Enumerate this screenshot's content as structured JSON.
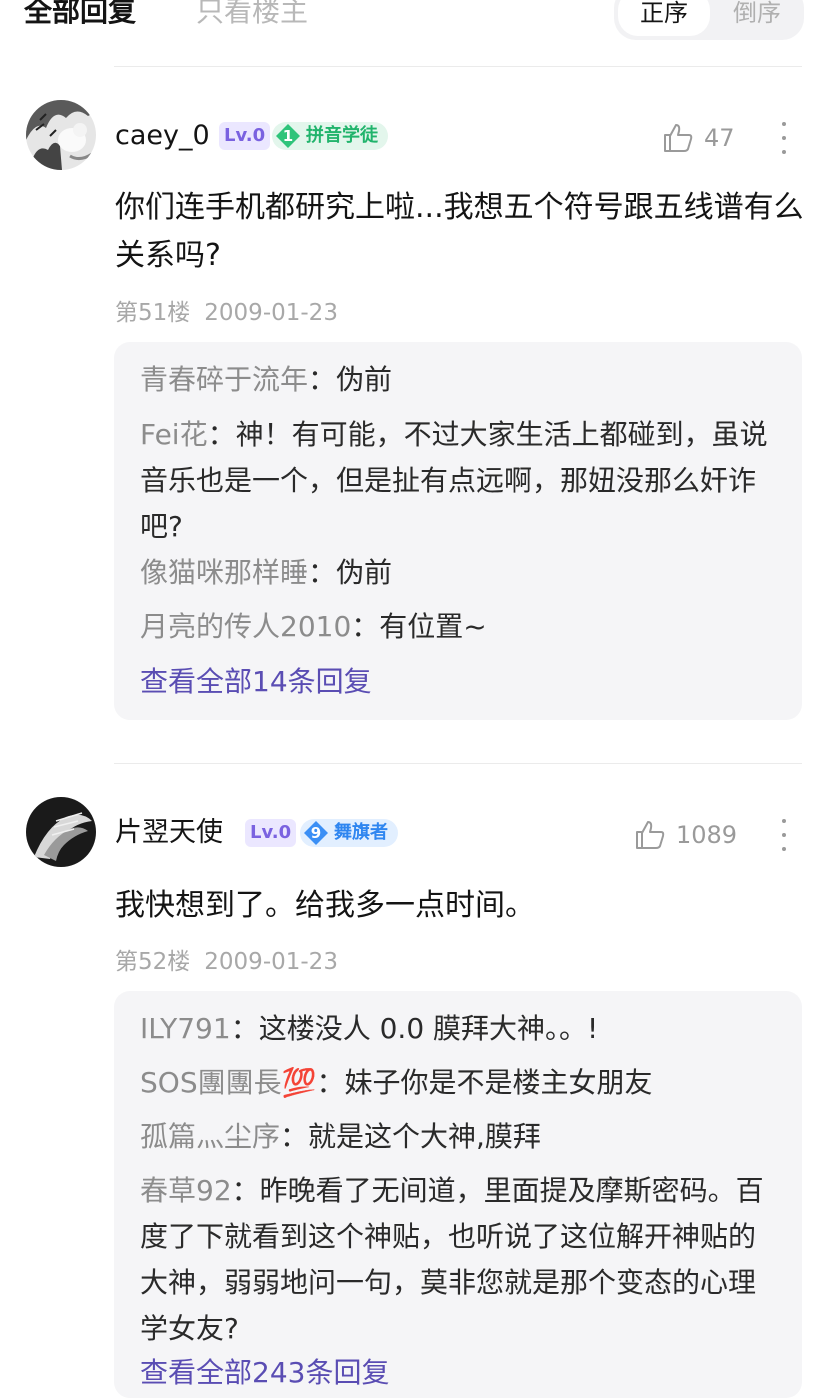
{
  "tabs": {
    "all_replies": "全部回复",
    "owner_only": "只看楼主",
    "sort_asc": "正序",
    "sort_desc": "倒序"
  },
  "posts": [
    {
      "username": "caey_0",
      "level": "Lv.0",
      "badge": {
        "number": "1",
        "title": "拼音学徒",
        "color": "#21b46c"
      },
      "likes": "47",
      "content": "你们连手机都研究上啦...我想五个符号跟五线谱有么关系吗?",
      "floor": "第51楼",
      "date": "2009-01-23",
      "replies": [
        {
          "name": "青春碎于流年",
          "text": "伪前"
        },
        {
          "name": "Fei花",
          "text": "神！有可能，不过大家生活上都碰到，虽说音乐也是一个，但是扯有点远啊，那妞没那么奸诈吧?"
        },
        {
          "name": "像猫咪那样睡",
          "text": "伪前"
        },
        {
          "name": "月亮的传人2010",
          "text": "有位置~"
        }
      ],
      "view_all": "查看全部14条回复"
    },
    {
      "username": "片翌天使",
      "level": "Lv.0",
      "badge": {
        "number": "9",
        "title": "舞旗者",
        "color": "#2f86f0"
      },
      "likes": "1089",
      "content": "我快想到了。给我多一点时间。",
      "floor": "第52楼",
      "date": "2009-01-23",
      "replies": [
        {
          "name": "ILY791",
          "text": "这楼没人 0.0 膜拜大神。。!"
        },
        {
          "name": "SOS團團長💯",
          "text": "妹子你是不是楼主女朋友"
        },
        {
          "name": "孤篇灬尘序",
          "text": "就是这个大神,膜拜"
        },
        {
          "name": "春草92",
          "text": "昨晚看了无间道，里面提及摩斯密码。百度了下就看到这个神贴，也听说了这位解开神贴的大神，弱弱地问一句，莫非您就是那个变态的心理学女友?"
        }
      ],
      "view_all": "查看全部243条回复"
    }
  ]
}
